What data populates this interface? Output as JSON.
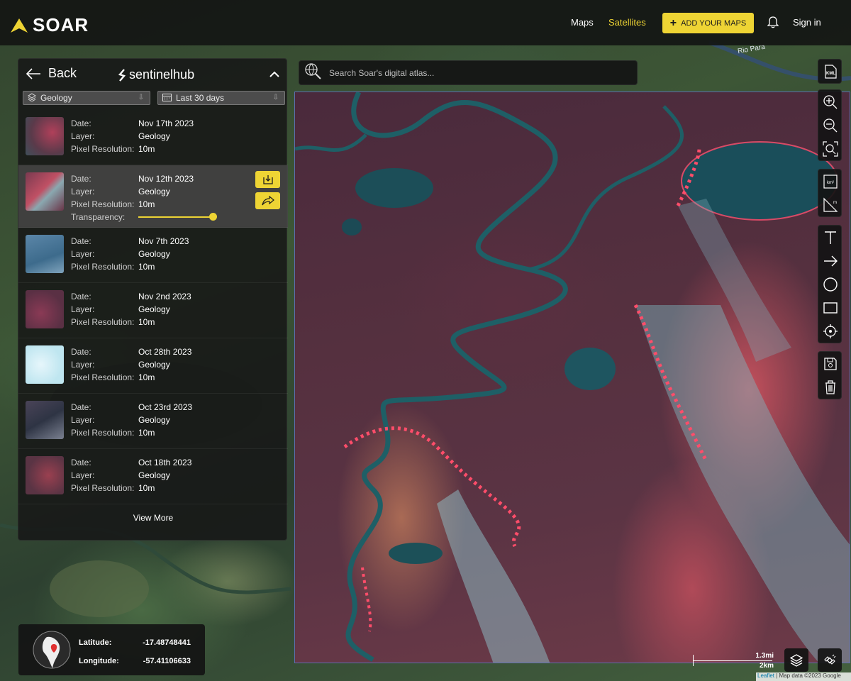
{
  "app": {
    "logo_text": "SOAR",
    "nav": {
      "maps": "Maps",
      "satellites": "Satellites",
      "add_maps": "ADD YOUR MAPS",
      "sign_in": "Sign in"
    },
    "accent_color": "#eed434"
  },
  "panel": {
    "back_label": "Back",
    "provider": "sentinelhub",
    "filters": {
      "layer": "Geology",
      "date_range": "Last 30 days"
    },
    "field_labels": {
      "date": "Date:",
      "layer": "Layer:",
      "resolution": "Pixel Resolution:",
      "transparency": "Transparency:"
    },
    "results": [
      {
        "date": "Nov 17th 2023",
        "layer": "Geology",
        "resolution": "10m"
      },
      {
        "date": "Nov 12th 2023",
        "layer": "Geology",
        "resolution": "10m",
        "selected": true,
        "transparency": 1.0
      },
      {
        "date": "Nov 7th 2023",
        "layer": "Geology",
        "resolution": "10m"
      },
      {
        "date": "Nov 2nd 2023",
        "layer": "Geology",
        "resolution": "10m"
      },
      {
        "date": "Oct 28th 2023",
        "layer": "Geology",
        "resolution": "10m"
      },
      {
        "date": "Oct 23rd 2023",
        "layer": "Geology",
        "resolution": "10m"
      },
      {
        "date": "Oct 18th 2023",
        "layer": "Geology",
        "resolution": "10m"
      }
    ],
    "view_more": "View More"
  },
  "search": {
    "placeholder": "Search Soar's digital atlas..."
  },
  "toolbar": {
    "kml_label": "KML",
    "area_label": "km²",
    "distance_label": "m",
    "tools": [
      "kml-icon",
      "zoom-in-icon",
      "zoom-out-icon",
      "zoom-fit-icon",
      "area-measure-icon",
      "distance-measure-icon",
      "text-icon",
      "arrow-icon",
      "circle-icon",
      "rectangle-icon",
      "point-icon",
      "save-icon",
      "trash-icon"
    ]
  },
  "coords": {
    "lat_label": "Latitude:",
    "lat": "-17.48748441",
    "lon_label": "Longitude:",
    "lon": "-57.41106633"
  },
  "scale": {
    "mi": "1.3mi",
    "km": "2km"
  },
  "map": {
    "river_label": "Rio Para"
  },
  "attribution": {
    "leaflet": "Leaflet",
    "rest": " | Map data ©2023 Google"
  }
}
